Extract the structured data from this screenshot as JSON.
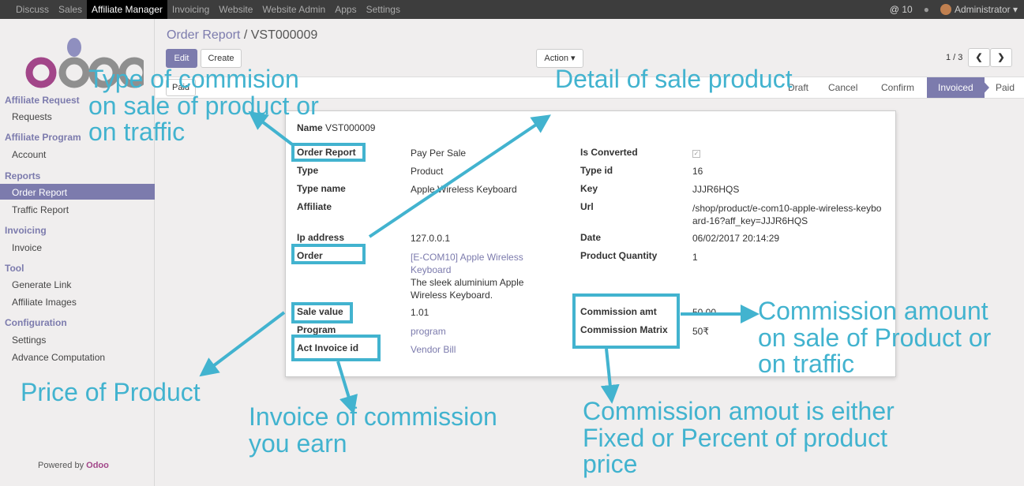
{
  "topbar": {
    "menu": [
      "Discuss",
      "Sales",
      "Affiliate Manager",
      "Invoicing",
      "Website",
      "Website Admin",
      "Apps",
      "Settings"
    ],
    "active_menu": "Affiliate Manager",
    "messages": "10",
    "user": "Administrator"
  },
  "sidebar": {
    "sections": [
      {
        "title": "Affiliate Request",
        "items": [
          "Requests"
        ]
      },
      {
        "title": "Affiliate Program",
        "items": [
          "Account"
        ]
      },
      {
        "title": "Reports",
        "items": [
          "Order Report",
          "Traffic Report"
        ]
      },
      {
        "title": "Invoicing",
        "items": [
          "Invoice"
        ]
      },
      {
        "title": "Tool",
        "items": [
          "Generate Link",
          "Affiliate Images"
        ]
      },
      {
        "title": "Configuration",
        "items": [
          "Settings",
          "Advance Computation"
        ]
      }
    ],
    "active_item": "Order Report",
    "powered_prefix": "Powered by",
    "powered_brand": "Odoo"
  },
  "breadcrumb": {
    "parent": "Order Report",
    "separator": "/",
    "current": "VST000009"
  },
  "buttons": {
    "edit": "Edit",
    "create": "Create",
    "action": "Action",
    "paid": "Paid"
  },
  "pager": {
    "label": "1 / 3"
  },
  "stages": [
    "Draft",
    "Cancel",
    "Confirm",
    "Invoiced",
    "Paid"
  ],
  "current_stage": "Invoiced",
  "form": {
    "name_label": "Name",
    "name_value": "VST000009",
    "order_report_label": "Order Report",
    "order_report_value": "Pay Per Sale",
    "type_label": "Type",
    "type_value": "Product",
    "type_name_label": "Type name",
    "type_name_value": "Apple Wireless Keyboard",
    "affiliate_label": "Affiliate",
    "affiliate_value": "",
    "ip_label": "Ip address",
    "ip_value": "127.0.0.1",
    "order_label": "Order",
    "order_value": "[E-COM10] Apple Wireless Keyboard",
    "order_desc": "The sleek aluminium Apple Wireless Keyboard.",
    "sale_value_label": "Sale value",
    "sale_value_value": "1.01",
    "program_label": "Program",
    "program_value": "program",
    "act_invoice_label": "Act Invoice id",
    "act_invoice_value": "Vendor Bill",
    "is_converted_label": "Is Converted",
    "type_id_label": "Type id",
    "type_id_value": "16",
    "key_label": "Key",
    "key_value": "JJJR6HQS",
    "url_label": "Url",
    "url_value": "/shop/product/e-com10-apple-wireless-keyboard-16?aff_key=JJJR6HQS",
    "date_label": "Date",
    "date_value": "06/02/2017 20:14:29",
    "product_qty_label": "Product Quantity",
    "product_qty_value": "1",
    "commission_amt_label": "Commission amt",
    "commission_amt_value": "50.00",
    "commission_matrix_label": "Commission Matrix",
    "commission_matrix_value": "50₹"
  },
  "annotations": {
    "type_commission": "Type of commision on sale of product or on traffic",
    "detail_sale": "Detail of sale product",
    "commission_amount": "Commission amount on sale of Product or on traffic",
    "price_product": "Price of Product",
    "invoice_commission": "Invoice of commission you earn",
    "commission_fixed": "Commission amout is either Fixed or Percent of product price"
  },
  "colors": {
    "accent": "#7c7bad",
    "annotation": "#42b3cf",
    "topbar": "#3d3d3d"
  }
}
